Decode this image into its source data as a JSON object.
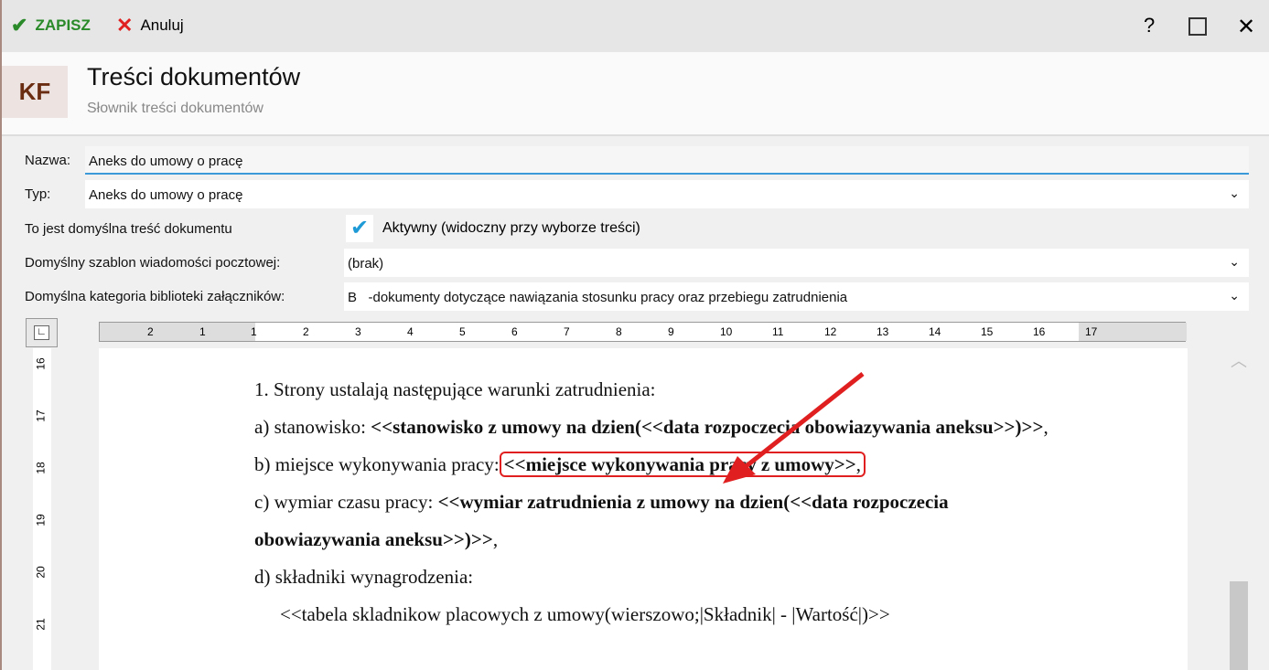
{
  "toolbar": {
    "save": "ZAPISZ",
    "cancel": "Anuluj",
    "help": "?"
  },
  "header": {
    "logo": "KF",
    "title": "Treści dokumentów",
    "subtitle": "Słownik treści dokumentów"
  },
  "form": {
    "name_label": "Nazwa:",
    "name_value": "Aneks do umowy o pracę",
    "type_label": "Typ:",
    "type_value": "Aneks do umowy o pracę",
    "default_label": "To jest domyślna treść dokumentu",
    "active_label": "Aktywny (widoczny przy wyborze treści)",
    "active_checked": true,
    "mail_label": "Domyślny szablon wiadomości pocztowej:",
    "mail_value": "(brak)",
    "cat_label": "Domyślna kategoria biblioteki załączników:",
    "cat_value": "B   -dokumenty dotyczące nawiązania stosunku pracy oraz przebiegu zatrudnienia"
  },
  "ruler": {
    "h": [
      "2",
      "1",
      "1",
      "2",
      "3",
      "4",
      "5",
      "6",
      "7",
      "8",
      "9",
      "10",
      "11",
      "12",
      "13",
      "14",
      "15",
      "16",
      "17"
    ],
    "v": [
      "16",
      "17",
      "18",
      "19",
      "20",
      "21"
    ]
  },
  "doc": {
    "l1": "1. Strony ustalają następujące warunki zatrudnienia:",
    "a_pre": "a) stanowisko: ",
    "a_bold": "<<stanowisko z umowy na dzien(<<data rozpoczecia obowiazywania aneksu>>)>>",
    "a_post": ",",
    "b_pre": "b) miejsce wykonywania pracy:",
    "b_bold": "<<miejsce wykonywania pracy z umowy>>",
    "b_post": ",",
    "c_pre": "c) wymiar czasu pracy:  ",
    "c_bold": "<<wymiar zatrudnienia z umowy na dzien(<<data rozpoczecia obowiazywania aneksu>>)>>",
    "c_post": ",",
    "d": "d) składniki wynagrodzenia:",
    "table": "<<tabela skladnikow placowych z umowy(wierszowo;|Składnik| - |Wartość|)>>"
  },
  "colors": {
    "accent": "#e02020",
    "green": "#2a8a2a"
  }
}
